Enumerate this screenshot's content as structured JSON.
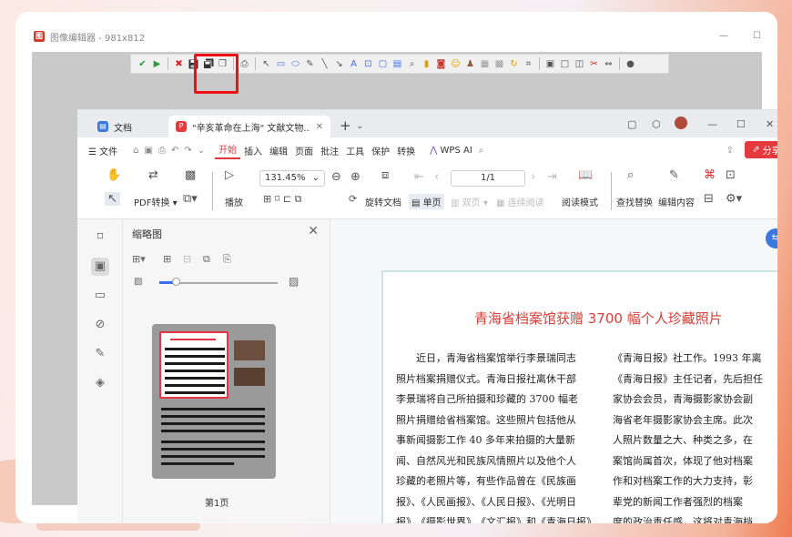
{
  "window": {
    "title": "图像编辑器 - 981x812",
    "min_icon": "minimize-icon",
    "max_icon": "maximize-icon"
  },
  "editor_toolbar": {
    "icons": [
      "check-icon",
      "play-icon",
      "cancel-icon",
      "save-icon",
      "save-as-icon",
      "copy-icon",
      "print-icon",
      "pointer-icon",
      "rect-select-icon",
      "ellipse-select-icon",
      "pen-icon",
      "line-icon",
      "arrow-icon",
      "text-icon",
      "text-box-icon",
      "callout-icon",
      "comment-icon",
      "magnifier-icon",
      "highlight-icon",
      "stamp-icon",
      "emoji-icon",
      "blur-icon",
      "pixelate-icon",
      "grid-icon",
      "rotate-icon",
      "crop-icon",
      "frame-icon",
      "border-icon",
      "shadow-icon",
      "effects-icon",
      "resize-icon",
      "more-icon"
    ]
  },
  "wps": {
    "tabs": [
      {
        "label": "文档",
        "icon": "doc-icon"
      },
      {
        "label": "\"辛亥革命在上海\" 文献文物...",
        "icon": "pdf-icon"
      }
    ],
    "menu": {
      "file": "文件",
      "items": [
        "开始",
        "插入",
        "编辑",
        "页面",
        "批注",
        "工具",
        "保护",
        "转换"
      ],
      "ai": "WPS AI",
      "share": "分享"
    },
    "ribbon": {
      "pdf_convert": "PDF转换",
      "play": "播放",
      "zoom": "131.45%",
      "page": "1/1",
      "rotate": "旋转文档",
      "single": "单页",
      "double": "双页",
      "continuous": "连续阅读",
      "reading": "阅读模式",
      "find": "查找替换",
      "edit": "编辑内容"
    },
    "thumb_panel": {
      "title": "缩略图",
      "page_label": "第1页"
    },
    "document": {
      "title": "青海省档案馆获赠 3700 幅个人珍藏照片",
      "col1": [
        "近日，青海省档案馆举行李景瑞同志",
        "照片档案捐赠仪式。青海日报社离休干部",
        "李景瑞将自己所拍摄和珍藏的 3700 幅老",
        "照片捐赠给省档案馆。这些照片包括他从",
        "事新闻摄影工作 40 多年来拍摄的大量新",
        "闻、自然风光和民族风情照片以及他个人",
        "珍藏的老照片等，有些作品曾在《民族画",
        "报》、《人民画报》、《人民日报》、《光明日",
        "报》、《摄影世界》、《文汇报》和《青海日报》"
      ],
      "col2": [
        "《青海日报》社工作。1993 年离",
        "《青海日报》主任记者，先后担任",
        "家协会会员，青海摄影家协会副",
        "海省老年摄影家协会主席。此次",
        "人照片数量之大、种类之多，在",
        "案馆尚属首次，体现了他对档案",
        "作和对档案工作的大力支持，彰",
        "辈党的新闻工作者强烈的档案",
        "度的政治责任感，这将对青海档"
      ]
    }
  }
}
